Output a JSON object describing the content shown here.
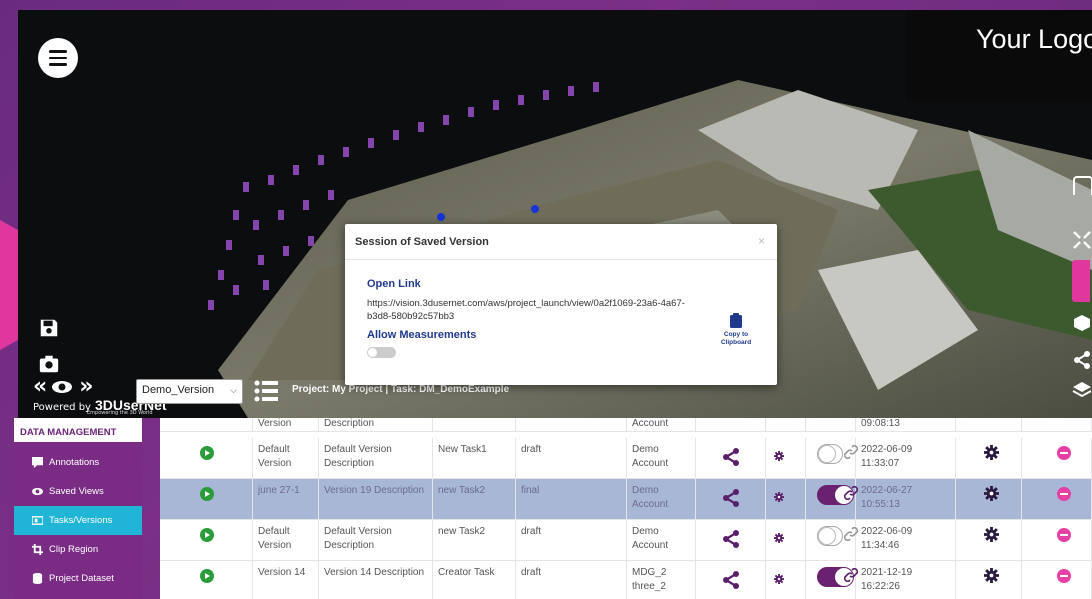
{
  "logo": {
    "text": "Your Logo"
  },
  "powered": {
    "label": "Powered by",
    "brand": "3DUserNet",
    "tagline": "Empowering the 3D World"
  },
  "viewer_bar": {
    "version_selected": "Demo_Version",
    "project_label": "Project: My Project | Task: DM_DemoExample"
  },
  "modal": {
    "title": "Session of Saved Version",
    "close": "×",
    "open_link_title": "Open Link",
    "link": "https://vision.3dusernet.com/aws/project_launch/view/0a2f1069-23a6-4a67-b3d8-580b92c57bb3",
    "copy_label": "Copy to Clipboard",
    "allow_title": "Allow Measurements"
  },
  "sidebar": {
    "header": "DATA MANAGEMENT",
    "items": [
      {
        "label": "Annotations",
        "icon": "annotation-icon",
        "active": false
      },
      {
        "label": "Saved Views",
        "icon": "eye-icon",
        "active": false
      },
      {
        "label": "Tasks/Versions",
        "icon": "tasks-icon",
        "active": true
      },
      {
        "label": "Clip Region",
        "icon": "crop-icon",
        "active": false
      },
      {
        "label": "Project Dataset",
        "icon": "database-icon",
        "active": false
      }
    ]
  },
  "table": {
    "partial_row": {
      "name": "Version",
      "description": "Description",
      "task": "",
      "status": "",
      "owner": "Account",
      "time": "09:08:13"
    },
    "rows": [
      {
        "name": "Default Version",
        "description": "Default Version Description",
        "task": "New Task1",
        "status": "draft",
        "owner": "Demo Account",
        "toggle_on": false,
        "date": "2022-06-09",
        "time": "11:33:07",
        "selected": false
      },
      {
        "name": "june 27-1",
        "description": "Version 19 Description",
        "task": "new Task2",
        "status": "final",
        "owner": "Demo Account",
        "toggle_on": true,
        "date": "2022-06-27",
        "time": "10:55:13",
        "selected": true
      },
      {
        "name": "Default Version",
        "description": "Default Version Description",
        "task": "new Task2",
        "status": "draft",
        "owner": "Demo Account",
        "toggle_on": false,
        "date": "2022-06-09",
        "time": "11:34:46",
        "selected": false
      },
      {
        "name": "Version 14",
        "description": "Version 14 Description",
        "task": "Creator Task",
        "status": "draft",
        "owner": "MDG_2 three_2",
        "toggle_on": true,
        "date": "2021-12-19",
        "time": "16:22:26",
        "selected": false
      }
    ]
  },
  "colors": {
    "brand_purple": "#7a2b84",
    "active_tab": "#20b4d6",
    "selected_row": "#a7b7d5",
    "toggle_on": "#6a2270",
    "play_green": "#2a9d3a",
    "remove_pink": "#e83fa5"
  }
}
